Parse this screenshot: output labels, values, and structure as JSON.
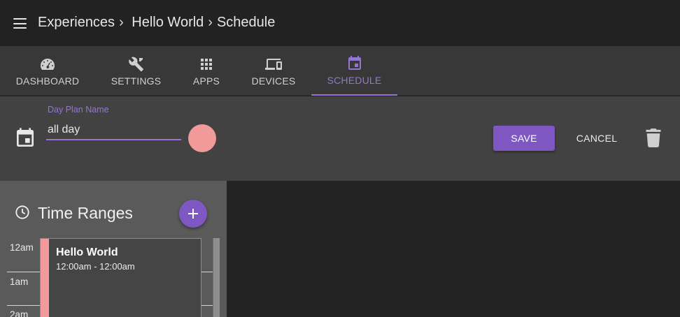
{
  "header": {
    "breadcrumb": [
      "Experiences",
      "Hello World",
      "Schedule"
    ],
    "separator": "›"
  },
  "tabs": [
    {
      "label": "DASHBOARD",
      "icon": "dashboard-icon",
      "active": false
    },
    {
      "label": "SETTINGS",
      "icon": "wrench-screwdriver-icon",
      "active": false
    },
    {
      "label": "APPS",
      "icon": "apps-grid-icon",
      "active": false
    },
    {
      "label": "DEVICES",
      "icon": "devices-icon",
      "active": false
    },
    {
      "label": "SCHEDULE",
      "icon": "calendar-icon",
      "active": true
    }
  ],
  "editor": {
    "field_label": "Day Plan Name",
    "field_value": "all day",
    "color": "#f09a9a",
    "save_label": "SAVE",
    "cancel_label": "CANCEL"
  },
  "time_ranges": {
    "title": "Time Ranges",
    "hours": [
      "12am",
      "1am",
      "2am"
    ],
    "event": {
      "title": "Hello World",
      "time": "12:00am - 12:00am"
    }
  },
  "colors": {
    "accent": "#7e57c2",
    "accent_text": "#9575d4",
    "event_color": "#f09a9a"
  }
}
